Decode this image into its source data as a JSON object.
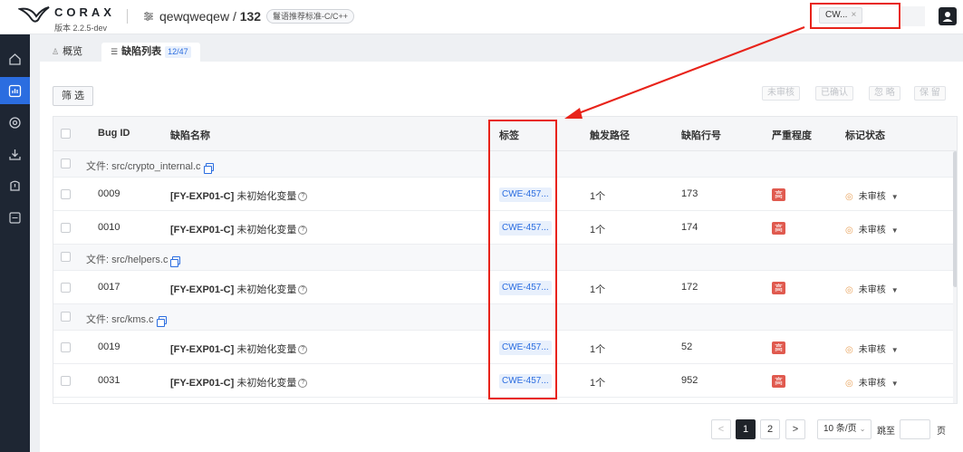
{
  "app": {
    "logo_text": "CORAX",
    "version": "版本 2.2.5-dev"
  },
  "project": {
    "name": "qewqweqew",
    "separator": " / ",
    "id": "132",
    "rule_set": "鬘语推荐标准-C/C++"
  },
  "header": {
    "filter_chip": "CW...",
    "filter_chip_close": "×"
  },
  "tabs": [
    {
      "label": "概览"
    },
    {
      "label": "缺陷列表",
      "count": "12/47"
    }
  ],
  "toolbar": {
    "filter_label": "筛 选",
    "actions": [
      "未审核",
      "已确认",
      "忽 略",
      "保 留"
    ]
  },
  "table": {
    "headers": {
      "bug_id": "Bug ID",
      "name": "缺陷名称",
      "tag": "标签",
      "path": "触发路径",
      "line": "缺陷行号",
      "severity": "严重程度",
      "status": "标记状态"
    },
    "groups": [
      {
        "file_label": "文件: src/crypto_internal.c",
        "rows": [
          {
            "id": "0009",
            "rule": "[FY-EXP01-C]",
            "name": "未初始化变量",
            "tag": "CWE-457...",
            "path": "1个",
            "line": "173",
            "severity": "高",
            "status": "未审核"
          },
          {
            "id": "0010",
            "rule": "[FY-EXP01-C]",
            "name": "未初始化变量",
            "tag": "CWE-457...",
            "path": "1个",
            "line": "174",
            "severity": "高",
            "status": "未审核"
          }
        ]
      },
      {
        "file_label": "文件: src/helpers.c",
        "rows": [
          {
            "id": "0017",
            "rule": "[FY-EXP01-C]",
            "name": "未初始化变量",
            "tag": "CWE-457...",
            "path": "1个",
            "line": "172",
            "severity": "高",
            "status": "未审核"
          }
        ]
      },
      {
        "file_label": "文件: src/kms.c",
        "rows": [
          {
            "id": "0019",
            "rule": "[FY-EXP01-C]",
            "name": "未初始化变量",
            "tag": "CWE-457...",
            "path": "1个",
            "line": "52",
            "severity": "高",
            "status": "未审核"
          },
          {
            "id": "0031",
            "rule": "[FY-EXP01-C]",
            "name": "未初始化变量",
            "tag": "CWE-457...",
            "path": "1个",
            "line": "952",
            "severity": "高",
            "status": "未审核"
          }
        ]
      }
    ]
  },
  "pagination": {
    "prev": "<",
    "pages": [
      "1",
      "2"
    ],
    "current": "1",
    "next": ">",
    "page_size": "10 条/页",
    "jump_label": "跳至",
    "page_unit": "页"
  },
  "colors": {
    "accent": "#2b6de0",
    "highlight": "#e8231a",
    "severity_high": "#e05a4f",
    "sidebar": "#1e2633"
  }
}
